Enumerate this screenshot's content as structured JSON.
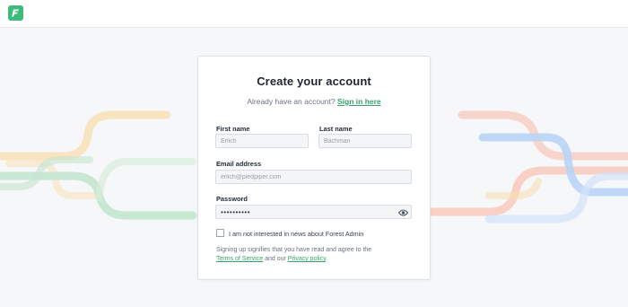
{
  "brand": {
    "logo_letter": "F",
    "logo_color": "#3dbb7a"
  },
  "card": {
    "title": "Create your account",
    "subtitle_prefix": "Already have an account?",
    "sign_in_link": "Sign in here",
    "first_name_label": "First name",
    "first_name_value": "Erlich",
    "last_name_label": "Last name",
    "last_name_value": "Bachman",
    "email_label": "Email address",
    "email_value": "erlich@piedpiper.com",
    "password_label": "Password",
    "password_value": "••••••••••",
    "newsletter_label": "I am not interested in news about Forest Admin",
    "legal_prefix": "Signing up signifies that you have read and agree to the",
    "terms_link": "Terms of Service",
    "legal_mid": "and our",
    "privacy_link": "Privacy policy",
    "legal_suffix": "."
  },
  "icons": {
    "password_toggle": "eye-icon",
    "logo": "forest-logo-icon"
  },
  "colors": {
    "accent": "#38a169",
    "deco_orange": "#f9d9a6",
    "deco_green": "#bfe2c9",
    "deco_red": "#f6c2b8",
    "deco_blue": "#bcd6f7"
  }
}
